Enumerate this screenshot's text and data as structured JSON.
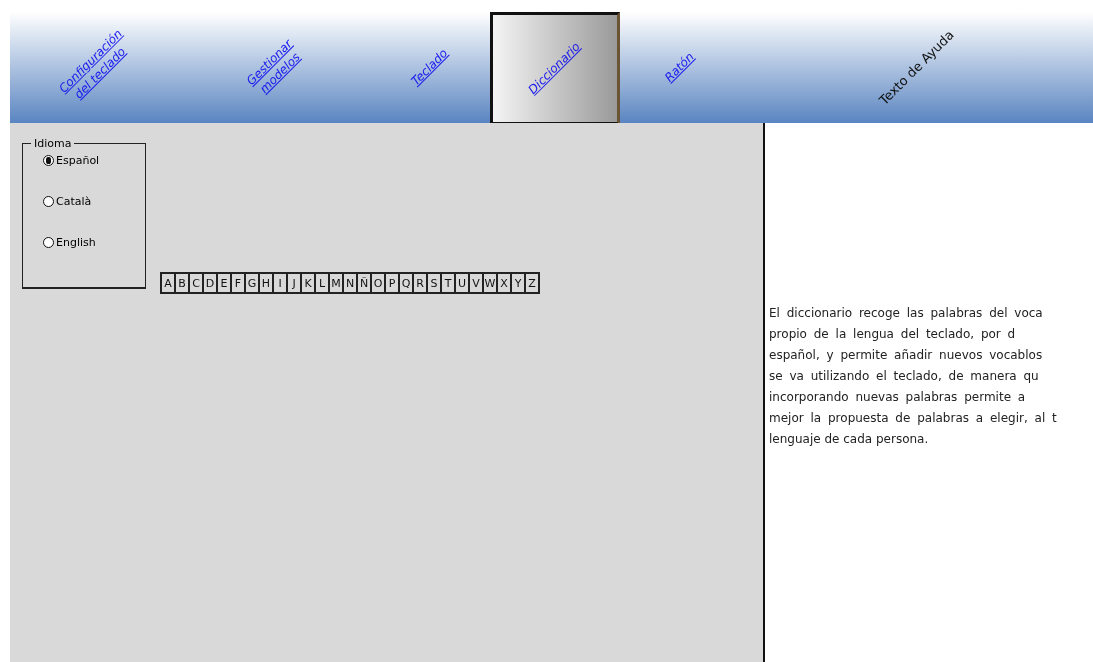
{
  "tabs": [
    {
      "label": "Configuración del teclado",
      "selected": false
    },
    {
      "label": "Gestionar modelos",
      "selected": false
    },
    {
      "label": "Teclado",
      "selected": false
    },
    {
      "label": "Diccionario",
      "selected": true
    },
    {
      "label": "Ratón",
      "selected": false
    }
  ],
  "help_heading": "Texto de Ayuda",
  "language_group": {
    "title": "Idioma",
    "options": [
      {
        "label": "Español",
        "selected": true
      },
      {
        "label": "Català",
        "selected": false
      },
      {
        "label": "English",
        "selected": false
      }
    ]
  },
  "letters": [
    "A",
    "B",
    "C",
    "D",
    "E",
    "F",
    "G",
    "H",
    "I",
    "J",
    "K",
    "L",
    "M",
    "N",
    "Ñ",
    "O",
    "P",
    "Q",
    "R",
    "S",
    "T",
    "U",
    "V",
    "W",
    "X",
    "Y",
    "Z"
  ],
  "help_text": [
    "El diccionario recoge las palabras del voca",
    "propio de la lengua del teclado, por d",
    "español, y permite añadir nuevos vocablos",
    "se va utilizando el teclado, de manera qu",
    "incorporando nuevas palabras permite a",
    "mejor la propuesta de palabras a elegir, al t",
    "lenguaje de cada persona."
  ]
}
